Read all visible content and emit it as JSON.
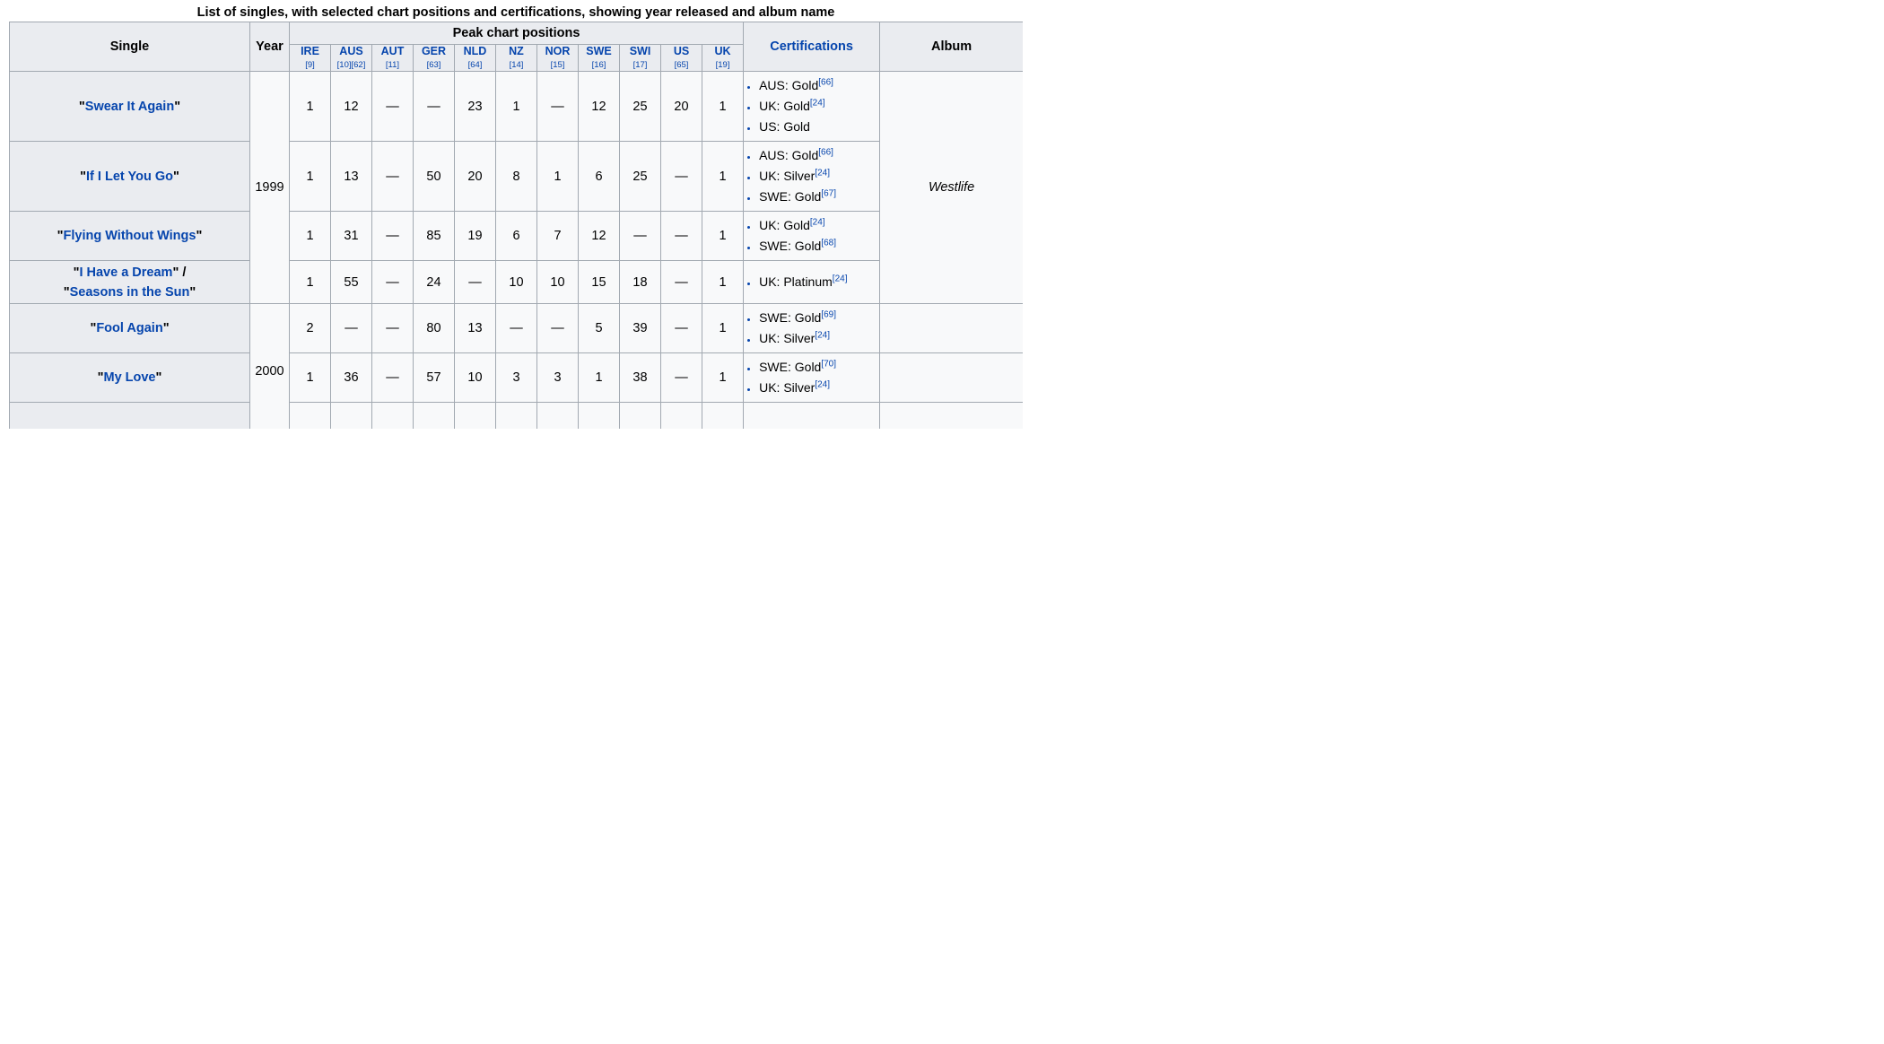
{
  "caption": "List of singles, with selected chart positions and certifications, showing year released and album name",
  "headers": {
    "single": "Single",
    "year": "Year",
    "peak": "Peak chart positions",
    "certifications": "Certifications",
    "album": "Album"
  },
  "charts": [
    {
      "label": "IRE",
      "ref": "[9]"
    },
    {
      "label": "AUS",
      "ref": "[10][62]"
    },
    {
      "label": "AUT",
      "ref": "[11]"
    },
    {
      "label": "GER",
      "ref": "[63]"
    },
    {
      "label": "NLD",
      "ref": "[64]"
    },
    {
      "label": "NZ",
      "ref": "[14]"
    },
    {
      "label": "NOR",
      "ref": "[15]"
    },
    {
      "label": "SWE",
      "ref": "[16]"
    },
    {
      "label": "SWI",
      "ref": "[17]"
    },
    {
      "label": "US",
      "ref": "[65]"
    },
    {
      "label": "UK",
      "ref": "[19]"
    }
  ],
  "years": [
    "1999",
    "2000"
  ],
  "album": "Westlife",
  "rows": [
    {
      "single": "\"Swear It Again\"",
      "positions": [
        "1",
        "12",
        "—",
        "—",
        "23",
        "1",
        "—",
        "12",
        "25",
        "20",
        "1"
      ],
      "certs": [
        {
          "text": "AUS: Gold",
          "ref": "[66]"
        },
        {
          "text": "UK: Gold",
          "ref": "[24]"
        },
        {
          "text": "US: Gold",
          "ref": ""
        }
      ]
    },
    {
      "single": "\"If I Let You Go\"",
      "positions": [
        "1",
        "13",
        "—",
        "50",
        "20",
        "8",
        "1",
        "6",
        "25",
        "—",
        "1"
      ],
      "certs": [
        {
          "text": "AUS: Gold",
          "ref": "[66]"
        },
        {
          "text": "UK: Silver",
          "ref": "[24]"
        },
        {
          "text": "SWE: Gold",
          "ref": "[67]"
        }
      ]
    },
    {
      "single": "\"Flying Without Wings\"",
      "positions": [
        "1",
        "31",
        "—",
        "85",
        "19",
        "6",
        "7",
        "12",
        "—",
        "—",
        "1"
      ],
      "certs": [
        {
          "text": "UK: Gold",
          "ref": "[24]"
        },
        {
          "text": "SWE: Gold",
          "ref": "[68]"
        }
      ]
    },
    {
      "single_lines": [
        "\"I Have a Dream\" /",
        "\"Seasons in the Sun\""
      ],
      "positions": [
        "1",
        "55",
        "—",
        "24",
        "—",
        "10",
        "10",
        "15",
        "18",
        "—",
        "1"
      ],
      "certs": [
        {
          "text": "UK: Platinum",
          "ref": "[24]"
        }
      ]
    },
    {
      "single": "\"Fool Again\"",
      "positions": [
        "2",
        "—",
        "—",
        "80",
        "13",
        "—",
        "—",
        "5",
        "39",
        "—",
        "1"
      ],
      "certs": [
        {
          "text": "SWE: Gold",
          "ref": "[69]"
        },
        {
          "text": "UK: Silver",
          "ref": "[24]"
        }
      ]
    },
    {
      "single": "\"My Love\"",
      "positions": [
        "1",
        "36",
        "—",
        "57",
        "10",
        "3",
        "3",
        "1",
        "38",
        "—",
        "1"
      ],
      "certs": [
        {
          "text": "SWE: Gold",
          "ref": "[70]"
        },
        {
          "text": "UK: Silver",
          "ref": "[24]"
        }
      ]
    }
  ]
}
